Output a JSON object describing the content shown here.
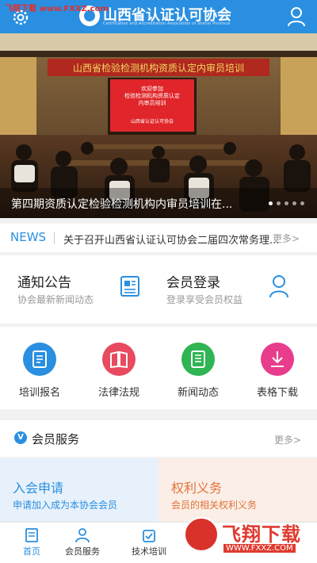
{
  "watermark_top": "飞翔下载 www.FXXZ.com",
  "header": {
    "title": "山西省认证认可协会",
    "subtitle": "Certification and Accreditation Association of Shanxi Province"
  },
  "banner": {
    "caption": "第四期资质认定检验检测机构内审员培训在...",
    "hall_banner": "山西省检验检测机构资质认定内审员培训",
    "screen_line1": "欢迎参加",
    "screen_line2": "检验检测机构资质认定",
    "screen_line3": "内审员培训",
    "screen_line4": "山西省认证认可协会",
    "dots": 5,
    "active_dot": 0
  },
  "news": {
    "tag": "NEWS",
    "text": "关于召开山西省认证认可协会二届四次常务理...",
    "more": "更多>"
  },
  "cards": [
    {
      "title": "通知公告",
      "subtitle": "协会最新新闻动态",
      "icon": "newspaper-icon"
    },
    {
      "title": "会员登录",
      "subtitle": "登录享受会员权益",
      "icon": "user-icon"
    }
  ],
  "grid": [
    {
      "label": "培训报名",
      "color": "#2a8fe0",
      "icon": "form-icon"
    },
    {
      "label": "法律法规",
      "color": "#e84a5f",
      "icon": "book-icon"
    },
    {
      "label": "新闻动态",
      "color": "#2fb553",
      "icon": "document-icon"
    },
    {
      "label": "表格下载",
      "color": "#e83d8c",
      "icon": "download-icon"
    }
  ],
  "member": {
    "badge": "V",
    "title": "会员服务",
    "more": "更多>"
  },
  "services": [
    {
      "title": "入会申请",
      "subtitle": "申请加入成为本协会会员"
    },
    {
      "title": "权利义务",
      "subtitle": "会员的相关权利义务"
    }
  ],
  "tabs": [
    {
      "label": "首页",
      "icon": "home-icon"
    },
    {
      "label": "会员服务",
      "icon": "members-icon"
    },
    {
      "label": "技术培训",
      "icon": "training-icon"
    }
  ],
  "colors": {
    "primary": "#2a8fe0",
    "accent_orange": "#e0733a"
  },
  "watermark": {
    "name": "飞翔下载",
    "url": "WWW.FXXZ.COM"
  }
}
